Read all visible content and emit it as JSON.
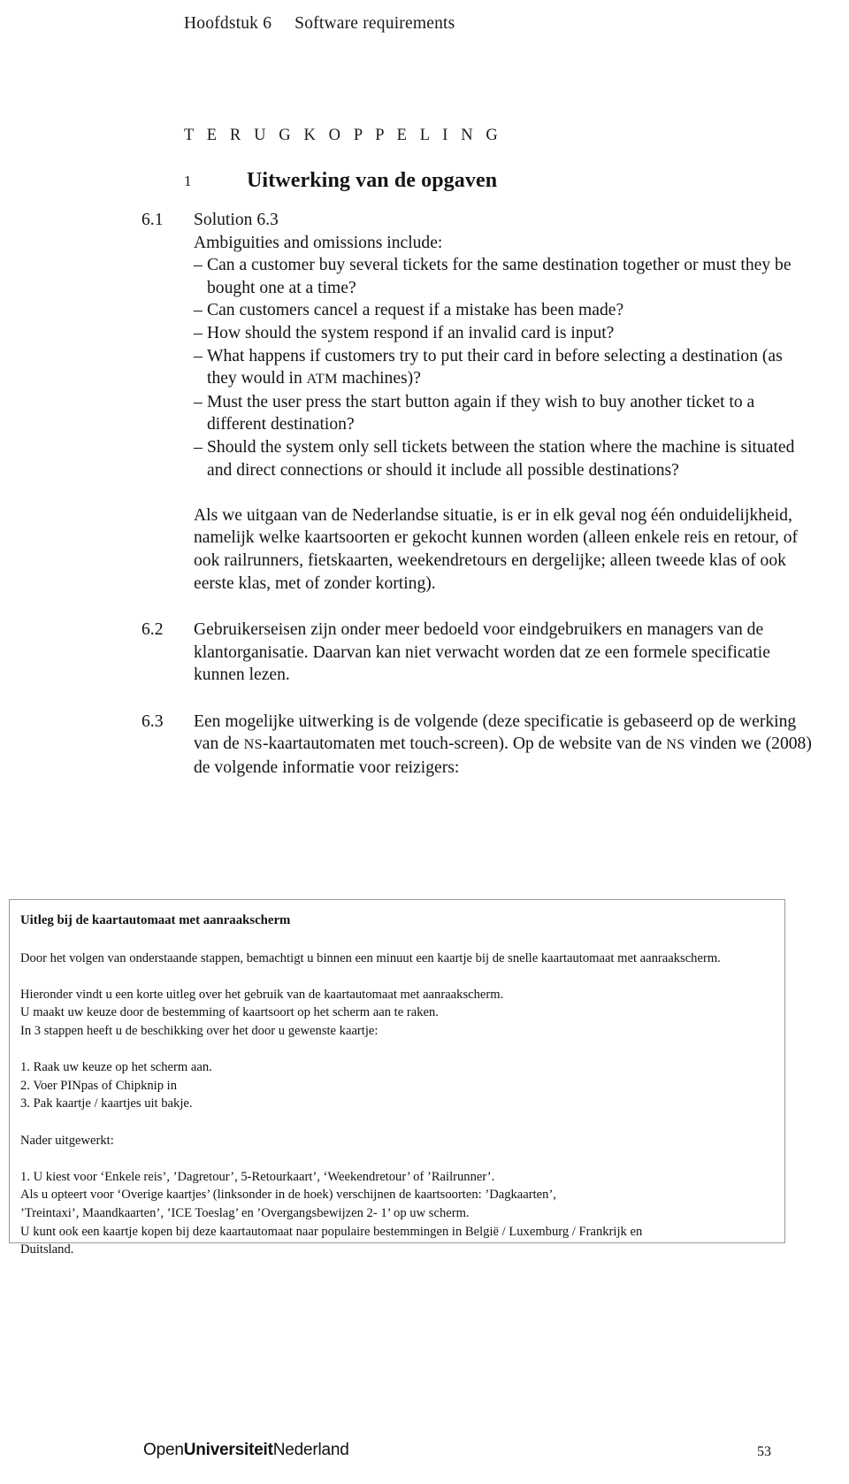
{
  "header": {
    "chapter": "Hoofdstuk 6",
    "title": "Software requirements"
  },
  "kicker": "T E R U G K O P P E L I N G",
  "section": {
    "number": "1",
    "title": "Uitwerking van de opgaven"
  },
  "answers": [
    {
      "number": "6.1",
      "heading": "Solution 6.3",
      "intro": "Ambiguities and omissions include:",
      "bullets": [
        "Can a customer buy several tickets for the same destination together or must they be bought one at a time?",
        "Can customers cancel a request if a mistake has been made?",
        "How should the system respond if an invalid card is input?",
        "What happens if customers try to put their card in before selecting a destination (as they would in ATM machines)?",
        "Must the user press the start button again if they wish to buy another ticket to a different destination?",
        "Should the system only sell tickets between the station where the machine is situated and direct connections or should it include all possible destinations?"
      ],
      "closing": "Als we uitgaan van de Nederlandse situatie, is er in elk geval nog één onduidelijkheid, namelijk welke kaartsoorten er gekocht kunnen worden (alleen enkele reis en retour, of ook railrunners, fietskaarten, weekendretours en dergelijke; alleen tweede klas of ook eerste klas, met of zonder korting)."
    },
    {
      "number": "6.2",
      "body": "Gebruikerseisen zijn onder meer bedoeld voor eindgebruikers en managers van de klantorganisatie. Daarvan kan niet verwacht worden dat ze een formele specificatie kunnen lezen."
    },
    {
      "number": "6.3",
      "body_part1": "Een mogelijke uitwerking is de volgende (deze specificatie is gebaseerd op de werking van de ",
      "abbr1": "NS",
      "body_part2": "-kaartautomaten met touch-screen). Op de website van de ",
      "abbr2": "NS",
      "body_part3": " vinden we (2008) de volgende informatie voor reizigers:"
    }
  ],
  "quotebox": {
    "title": "Uitleg bij de kaartautomaat met aanraakscherm",
    "intro": "Door het volgen van onderstaande stappen, bemachtigt u binnen een minuut een kaartje bij de snelle kaartautomaat met aanraakscherm.",
    "explain_lines": [
      "Hieronder vindt u een korte uitleg over het gebruik van de kaartautomaat met aanraakscherm.",
      "U maakt uw keuze door de bestemming of kaartsoort op het scherm aan te raken.",
      "In 3 stappen heeft u de beschikking over het door u gewenste kaartje:"
    ],
    "steps": [
      "1. Raak uw keuze op het scherm aan.",
      "2. Voer PINpas of Chipknip in",
      "3. Pak kaartje / kaartjes uit bakje."
    ],
    "detail_heading": "Nader uitgewerkt:",
    "detail_lines": [
      "1. U kiest voor ‘Enkele reis’, ’Dagretour’, 5-Retourkaart’, ‘Weekendretour’ of ’Railrunner’.",
      "Als u opteert voor ‘Overige kaartjes’ (linksonder in de hoek) verschijnen de kaartsoorten: ’Dagkaarten’,",
      "’Treintaxi’, Maandkaarten’, ’ICE Toeslag’ en ’Overgangsbewijzen 2- 1’ op uw scherm.",
      "U kunt ook een kaartje kopen bij deze kaartautomaat naar populaire bestemmingen in België / Luxemburg / Frankrijk en",
      "Duitsland."
    ]
  },
  "footer": {
    "logo_part1": "Open",
    "logo_part2": "Universiteit",
    "logo_part3": "Nederland",
    "page_number": "53"
  }
}
